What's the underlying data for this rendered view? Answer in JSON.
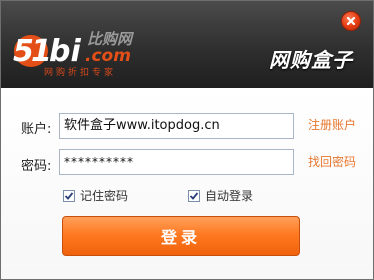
{
  "header": {
    "brand_sub": "网购折扣专家",
    "title": "网购盒子"
  },
  "form": {
    "account_label": "账户:",
    "account_value": "软件盒子www.itopdog.cn",
    "password_label": "密码:",
    "password_value": "**********",
    "register_link": "注册账户",
    "recover_link": "找回密码",
    "remember_label": "记住密码",
    "remember_checked": true,
    "autologin_label": "自动登录",
    "autologin_checked": true,
    "login_button": "登录"
  },
  "colors": {
    "accent": "#e8772e",
    "header_dark": "#2f2f2f"
  }
}
